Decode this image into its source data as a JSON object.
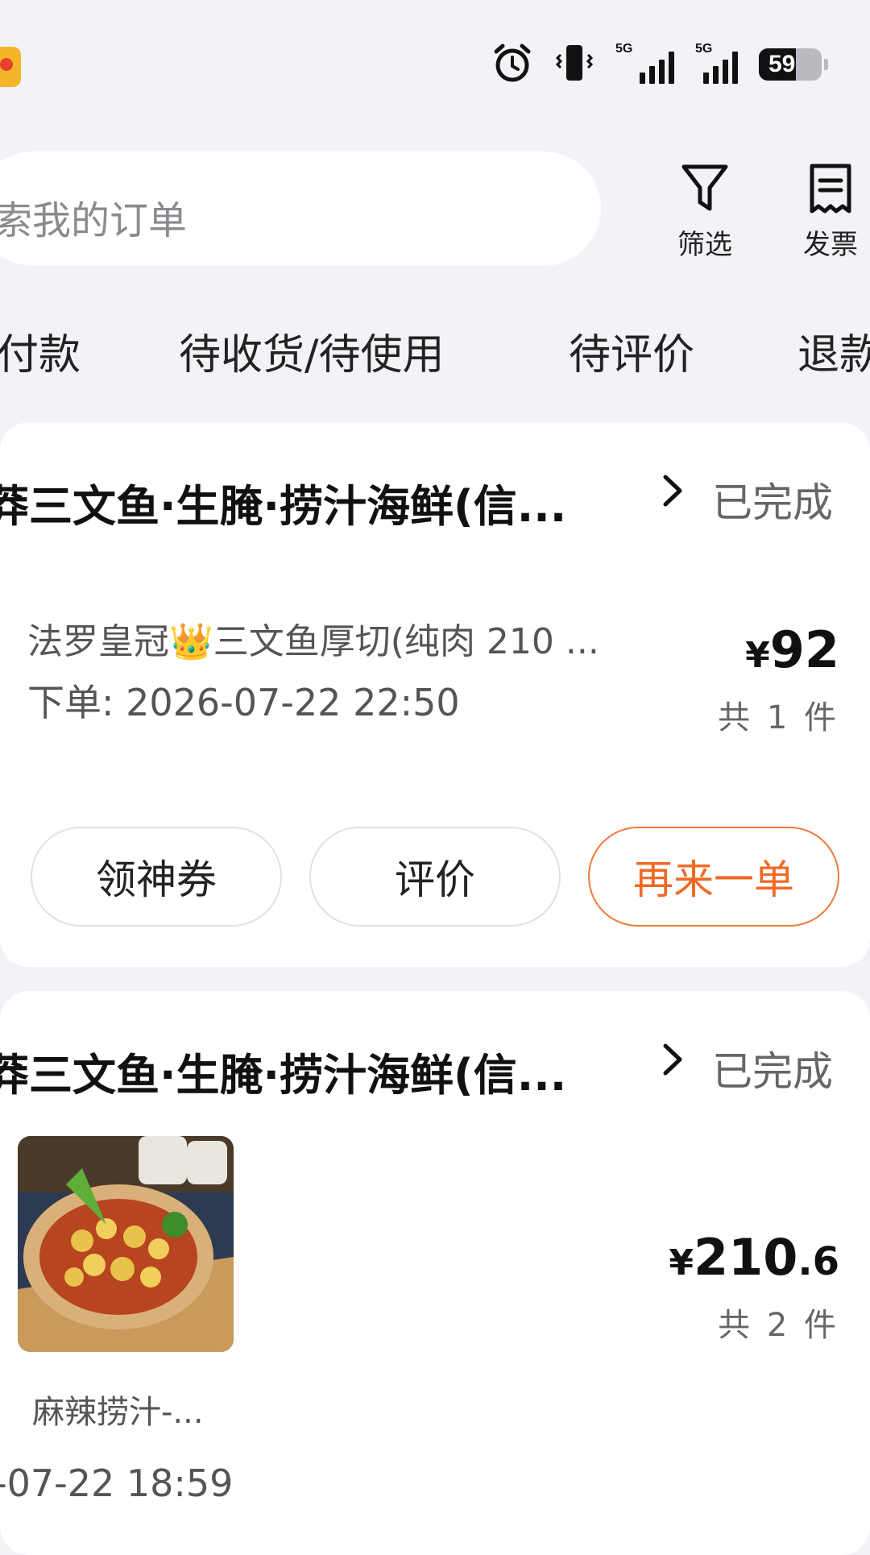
{
  "status_bar": {
    "battery": "59",
    "signal_labels": [
      "5G",
      "5G"
    ],
    "icons": [
      "alarm-icon",
      "vibrate-icon",
      "signal-icon",
      "battery-icon"
    ]
  },
  "search": {
    "placeholder": "索我的订单"
  },
  "toolbar": {
    "filter_label": "筛选",
    "invoice_label": "发票"
  },
  "tabs": [
    {
      "label": "付款"
    },
    {
      "label": "待收货/待使用"
    },
    {
      "label": "待评价"
    },
    {
      "label": "退款"
    }
  ],
  "orders": [
    {
      "shop": "莽三文鱼·生腌·捞汁海鲜(信...",
      "status": "已完成",
      "item_name": "法罗皇冠👑三文鱼厚切(纯肉 210 ...",
      "order_time": "下单: 2026-07-22 22:50",
      "price_symbol": "¥",
      "price_int": "92",
      "price_dec": "",
      "count": "共 1 件",
      "actions": [
        "领神券",
        "评价",
        "再来一单"
      ]
    },
    {
      "shop": "莽三文鱼·生腌·捞汁海鲜(信...",
      "status": "已完成",
      "item_name": "麻辣捞汁-...",
      "order_time": "-07-22 18:59",
      "price_symbol": "¥",
      "price_int": "210",
      "price_dec": ".6",
      "count": "共 2 件"
    }
  ],
  "colors": {
    "accent_orange": "#f06a26",
    "background": "#f2f3f7"
  }
}
